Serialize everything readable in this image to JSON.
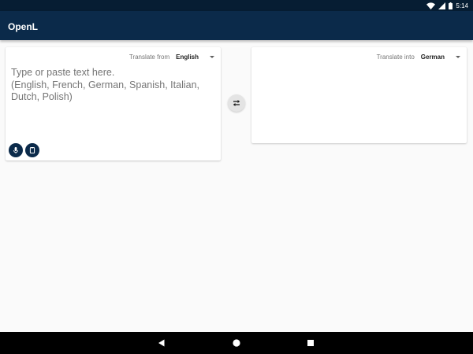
{
  "status_bar": {
    "time": "5:14"
  },
  "app_bar": {
    "title": "OpenL"
  },
  "source": {
    "language_label": "Translate from",
    "language": "English",
    "text_value": "",
    "placeholder": "Type or paste text here.\n(English, French, German, Spanish, Italian, Dutch, Polish)"
  },
  "target": {
    "language_label": "Translate into",
    "language": "German"
  },
  "icons": {
    "wifi": "wifi-icon",
    "signal": "signal-icon",
    "battery": "battery-icon",
    "mic": "microphone-icon",
    "clipboard": "clipboard-icon",
    "swap": "swap-icon",
    "back": "back-icon",
    "home": "home-icon",
    "recent": "recent-apps-icon"
  },
  "colors": {
    "status_bar": "#061d33",
    "app_bar": "#0b2a4a",
    "background": "#fafafa",
    "accent": "#0b2a4a"
  }
}
